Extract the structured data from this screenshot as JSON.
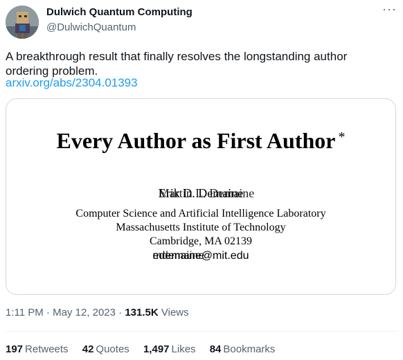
{
  "tweet": {
    "author_name": "Dulwich Quantum Computing",
    "handle": "@DulwichQuantum",
    "more_label": "···",
    "text": "A breakthrough result that finally resolves the longstanding author ordering problem.",
    "link": "arxiv.org/abs/2304.01393",
    "time": "1:11 PM",
    "date": "May 12, 2023",
    "views_count": "131.5K",
    "views_label": "Views",
    "stats": {
      "retweets": {
        "count": "197",
        "label": "Retweets"
      },
      "quotes": {
        "count": "42",
        "label": "Quotes"
      },
      "likes": {
        "count": "1,497",
        "label": "Likes"
      },
      "bookmarks": {
        "count": "84",
        "label": "Bookmarks"
      }
    }
  },
  "paper": {
    "title": "Every Author as First Author",
    "title_mark": "*",
    "author_a": "Erik D. Demaine",
    "author_b": "Martin L. Demaine",
    "affiliation_1": "Computer Science and Artificial Intelligence Laboratory",
    "affiliation_2": "Massachusetts Institute of Technology",
    "affiliation_3": "Cambridge, MA 02139",
    "email_user_a": "edemaine",
    "email_user_b": "mdemaine",
    "email_domain": "@mit.edu"
  },
  "colors": {
    "accent": "#1d9bf0",
    "secondary_text": "#536471",
    "border": "#cfd9de"
  }
}
